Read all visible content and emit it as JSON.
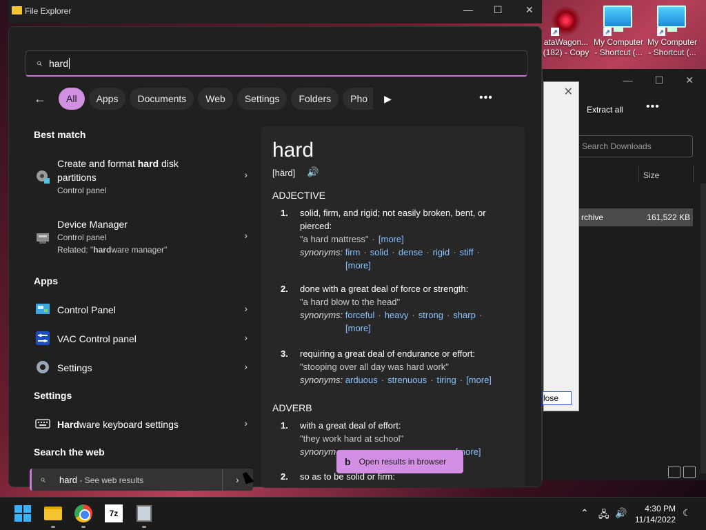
{
  "window": {
    "title": "File Explorer",
    "minimize": "—",
    "maximize": "☐",
    "close": "✕"
  },
  "desktop_icons": [
    {
      "label": "ataWagon...\n(182) - Copy",
      "icon": "star-logo-icon"
    },
    {
      "label": "My Computer - Shortcut (...",
      "icon": "monitor-icon"
    },
    {
      "label": "My Computer - Shortcut (...",
      "icon": "monitor-icon"
    }
  ],
  "background_window": {
    "extract_all": "Extract all",
    "more": "•••",
    "search_placeholder": "Search Downloads",
    "size_header": "Size",
    "row_name": "rchive",
    "row_size": "161,522 KB",
    "dialog_close": "lose"
  },
  "search": {
    "query": "hard",
    "filters": [
      "All",
      "Apps",
      "Documents",
      "Web",
      "Settings",
      "Folders",
      "Pho"
    ],
    "active_filter": "All",
    "more_dots": "•••"
  },
  "results": {
    "best_match_header": "Best match",
    "best_match": [
      {
        "title_pre": "Create and format ",
        "title_bold": "hard",
        "title_post": " disk partitions",
        "sub": "Control panel"
      },
      {
        "title": "Device Manager",
        "sub": "Control panel",
        "related_pre": "Related: \"",
        "related_bold": "hard",
        "related_post": "ware manager\""
      }
    ],
    "apps_header": "Apps",
    "apps": [
      "Control Panel",
      "VAC Control panel",
      "Settings"
    ],
    "settings_header": "Settings",
    "settings_item_bold": "Hard",
    "settings_item_rest": "ware keyboard settings",
    "web_header": "Search the web",
    "web_query": "hard",
    "web_suffix": " - See web results"
  },
  "dictionary": {
    "word": "hard",
    "pronunciation": "[härd]",
    "pos1": "ADJECTIVE",
    "adj_senses": [
      {
        "num": "1.",
        "def": "solid, firm, and rigid; not easily broken, bent, or pierced:",
        "ex": "\"a hard mattress\"",
        "more": "[more]",
        "synonyms": [
          "firm",
          "solid",
          "dense",
          "rigid",
          "stiff"
        ],
        "syn_more": "[more]"
      },
      {
        "num": "2.",
        "def": "done with a great deal of force or strength:",
        "ex": "\"a hard blow to the head\"",
        "synonyms": [
          "forceful",
          "heavy",
          "strong",
          "sharp"
        ],
        "syn_more": "[more]"
      },
      {
        "num": "3.",
        "def": "requiring a great deal of endurance or effort:",
        "ex": "\"stooping over all day was hard work\"",
        "synonyms": [
          "arduous",
          "strenuous",
          "tiring"
        ],
        "syn_more": "[more]"
      }
    ],
    "synonyms_label": "synonyms:",
    "pos2": "ADVERB",
    "adv_senses": [
      {
        "num": "1.",
        "def": "with a great deal of effort:",
        "ex": "\"they work hard at school\"",
        "syn_label": "synonym",
        "syn_more": "[more]"
      },
      {
        "num": "2.",
        "def": "so as to be solid or firm:"
      }
    ]
  },
  "toast": {
    "icon": "b",
    "label": "Open results in browser"
  },
  "taskbar": {
    "apps": [
      "windows-start",
      "file-explorer",
      "chrome",
      "7zip",
      "archiver"
    ],
    "time": "4:30 PM",
    "date": "11/14/2022"
  }
}
